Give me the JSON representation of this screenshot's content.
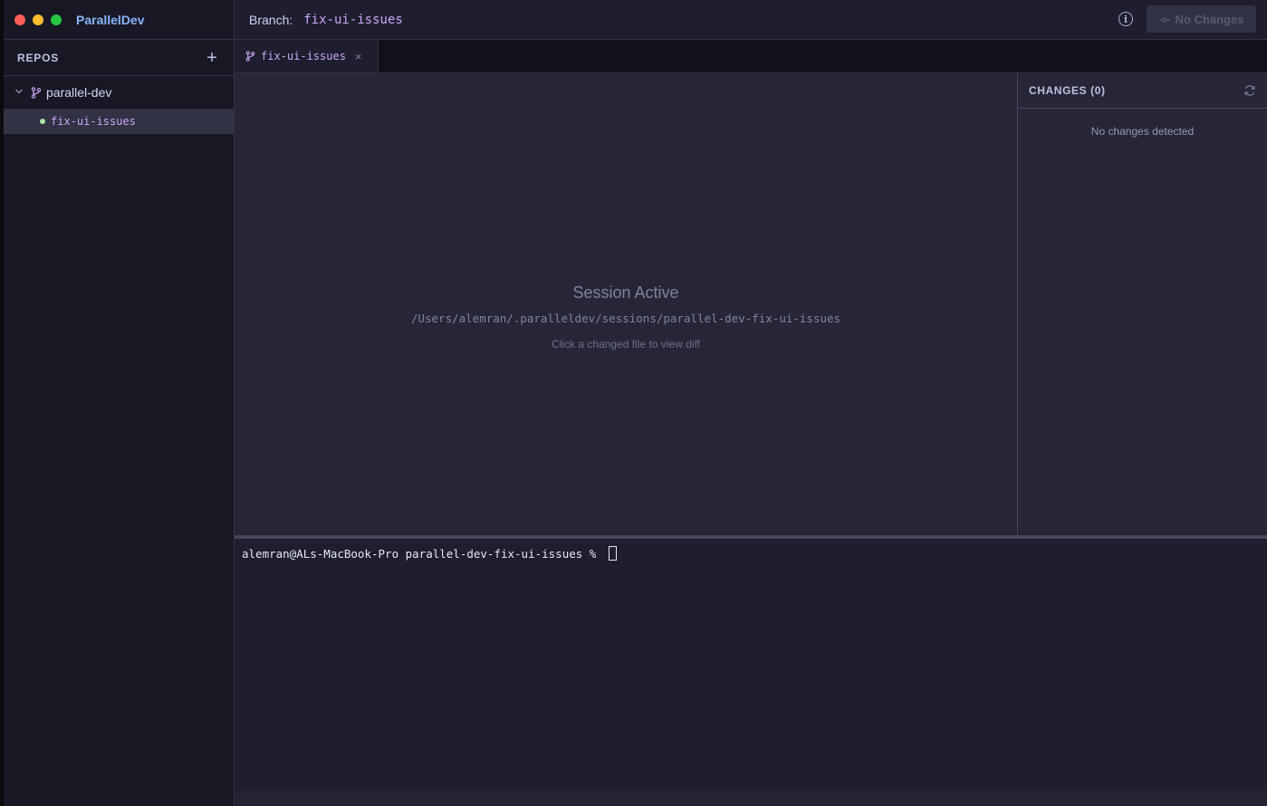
{
  "app": {
    "name": "ParallelDev"
  },
  "sidebar": {
    "section_title": "REPOS",
    "add_label": "+",
    "repos": [
      {
        "name": "parallel-dev",
        "branches": [
          {
            "name": "fix-ui-issues",
            "status": "active"
          }
        ]
      }
    ]
  },
  "topbar": {
    "branch_label": "Branch:",
    "branch_value": "fix-ui-issues",
    "no_changes_label": "No Changes"
  },
  "tabs": [
    {
      "label": "fix-ui-issues",
      "close": "×"
    }
  ],
  "viewer": {
    "title": "Session Active",
    "path": "/Users/alemran/.paralleldev/sessions/parallel-dev-fix-ui-issues",
    "hint": "Click a changed file to view diff"
  },
  "changes": {
    "title": "CHANGES (0)",
    "empty_text": "No changes detected"
  },
  "terminal": {
    "prompt": "alemran@ALs-MacBook-Pro parallel-dev-fix-ui-issues % "
  },
  "colors": {
    "accent_blue": "#89b4fa",
    "branch_purple": "#cba6f7",
    "status_green": "#a6e3a1"
  }
}
